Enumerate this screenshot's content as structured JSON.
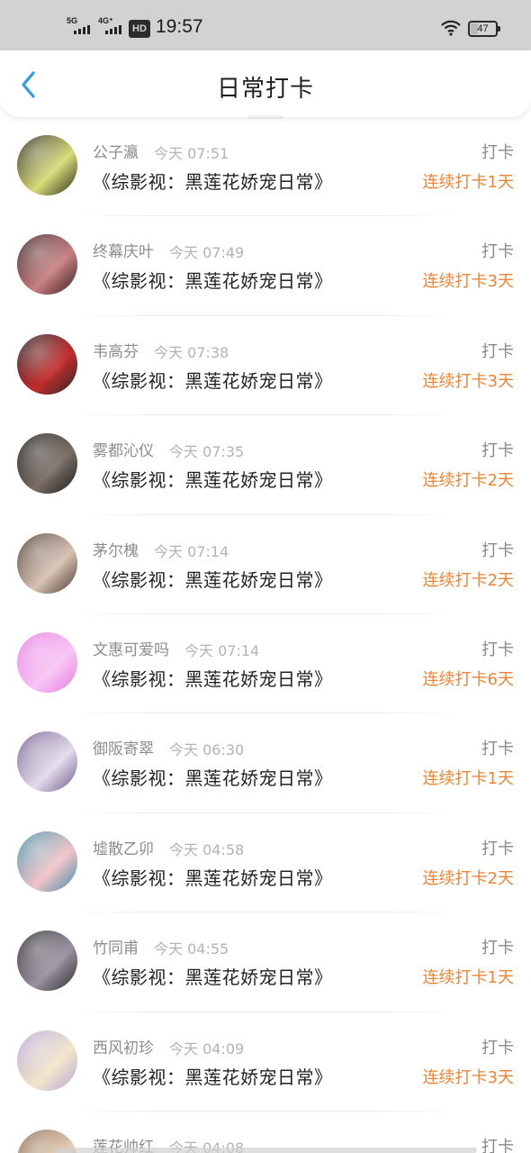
{
  "status_bar": {
    "network_1": "5G",
    "network_2": "4G⁺",
    "hd": "HD",
    "time": "19:57",
    "battery": "47",
    "battery_level_percent": 47
  },
  "header": {
    "title": "日常打卡",
    "back_icon": "chevron-left-icon"
  },
  "colors": {
    "accent_blue": "#2f9bf0",
    "streak_orange": "#f08434"
  },
  "checkins": [
    {
      "user": "公子瀛",
      "time": "今天 07:51",
      "book": "《综影视：黑莲花娇宠日常》",
      "label": "打卡",
      "streak": "连续打卡1天",
      "avatar_colors": [
        "#2b2a1a",
        "#d8db78"
      ]
    },
    {
      "user": "终幕庆叶",
      "time": "今天 07:49",
      "book": "《综影视：黑莲花娇宠日常》",
      "label": "打卡",
      "streak": "连续打卡3天",
      "avatar_colors": [
        "#3a1f22",
        "#c88080"
      ]
    },
    {
      "user": "韦高芬",
      "time": "今天 07:38",
      "book": "《综影视：黑莲花娇宠日常》",
      "label": "打卡",
      "streak": "连续打卡3天",
      "avatar_colors": [
        "#2a2a2a",
        "#c42b2b"
      ]
    },
    {
      "user": "雾都沁仪",
      "time": "今天 07:35",
      "book": "《综影视：黑莲花娇宠日常》",
      "label": "打卡",
      "streak": "连续打卡2天",
      "avatar_colors": [
        "#1c1c1c",
        "#7a6e66"
      ]
    },
    {
      "user": "茅尔槐",
      "time": "今天 07:14",
      "book": "《综影视：黑莲花娇宠日常》",
      "label": "打卡",
      "streak": "连续打卡2天",
      "avatar_colors": [
        "#4a3a2e",
        "#d8c2b4"
      ]
    },
    {
      "user": "文惠可爱吗",
      "time": "今天 07:14",
      "book": "《综影视：黑莲花娇宠日常》",
      "label": "打卡",
      "streak": "连续打卡6天",
      "avatar_colors": [
        "#e77ae3",
        "#f7c6f4"
      ]
    },
    {
      "user": "御阪寄翠",
      "time": "今天 06:30",
      "book": "《综影视：黑莲花娇宠日常》",
      "label": "打卡",
      "streak": "连续打卡1天",
      "avatar_colors": [
        "#6e5a8a",
        "#e4dcec"
      ]
    },
    {
      "user": "墟散乙卯",
      "time": "今天 04:58",
      "book": "《综影视：黑莲花娇宠日常》",
      "label": "打卡",
      "streak": "连续打卡2天",
      "avatar_colors": [
        "#3f8fa8",
        "#f2c4c8"
      ]
    },
    {
      "user": "竹同甫",
      "time": "今天 04:55",
      "book": "《综影视：黑莲花娇宠日常》",
      "label": "打卡",
      "streak": "连续打卡1天",
      "avatar_colors": [
        "#2e2c30",
        "#9a92a0"
      ]
    },
    {
      "user": "西风初珍",
      "time": "今天 04:09",
      "book": "《综影视：黑莲花娇宠日常》",
      "label": "打卡",
      "streak": "连续打卡3天",
      "avatar_colors": [
        "#b7a6d8",
        "#f1e6c9"
      ]
    },
    {
      "user": "莲花帅红",
      "time": "今天 04:08",
      "book": "",
      "label": "打卡",
      "streak": "",
      "avatar_colors": [
        "#8a6a52",
        "#e6cdb4"
      ]
    }
  ]
}
